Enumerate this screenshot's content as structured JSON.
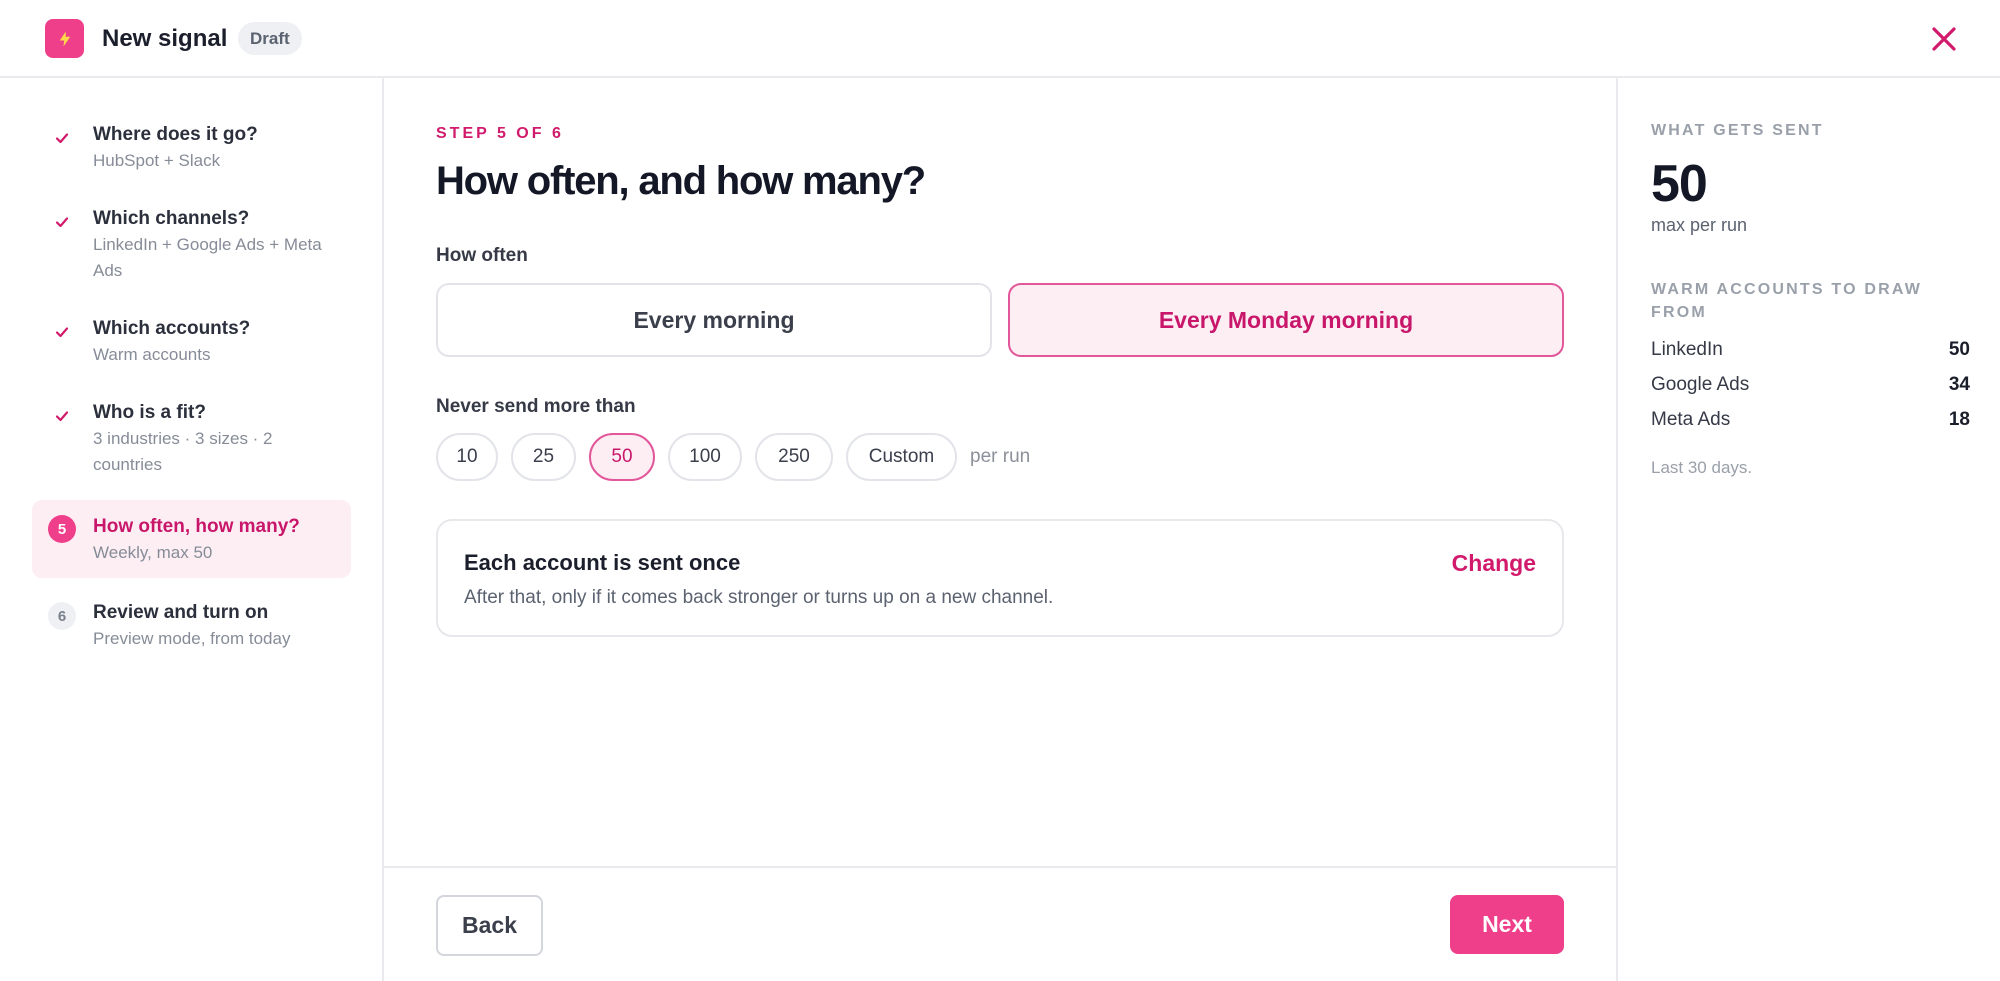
{
  "header": {
    "title": "New signal",
    "badge": "Draft",
    "logo_icon": "lightning-bolt-icon",
    "close_icon": "close-icon"
  },
  "colors": {
    "accent": "#ef3f8a",
    "accent_text": "#c8176a",
    "accent_bg": "#fdeef4"
  },
  "steps": [
    {
      "status": "done",
      "title": "Where does it go?",
      "subtitle": "HubSpot + Slack"
    },
    {
      "status": "done",
      "title": "Which channels?",
      "subtitle": "LinkedIn + Google Ads + Meta Ads"
    },
    {
      "status": "done",
      "title": "Which accounts?",
      "subtitle": "Warm accounts"
    },
    {
      "status": "done",
      "title": "Who is a fit?",
      "subtitle": "3 industries · 3 sizes · 2 countries"
    },
    {
      "status": "active",
      "number": "5",
      "title": "How often, how many?",
      "subtitle": "Weekly, max 50"
    },
    {
      "status": "pending",
      "number": "6",
      "title": "Review and turn on",
      "subtitle": "Preview mode, from today"
    }
  ],
  "main": {
    "eyebrow": "STEP 5 OF 6",
    "title": "How often, and how many?",
    "frequency": {
      "label": "How often",
      "options": [
        "Every morning",
        "Every Monday morning"
      ],
      "selected": "Every Monday morning"
    },
    "limit": {
      "label": "Never send more than",
      "options": [
        "10",
        "25",
        "50",
        "100",
        "250",
        "Custom"
      ],
      "selected": "50",
      "suffix": "per run"
    },
    "info": {
      "title": "Each account is sent once",
      "subtitle": "After that, only if it comes back stronger or turns up on a new channel.",
      "action": "Change"
    },
    "footer": {
      "back": "Back",
      "next": "Next"
    }
  },
  "panel": {
    "eyebrow": "WHAT GETS SENT",
    "big_number": "50",
    "big_caption": "max per run",
    "accounts_heading": "WARM ACCOUNTS TO DRAW FROM",
    "accounts": [
      {
        "name": "LinkedIn",
        "count": "50"
      },
      {
        "name": "Google Ads",
        "count": "34"
      },
      {
        "name": "Meta Ads",
        "count": "18"
      }
    ],
    "note": "Last 30 days."
  }
}
